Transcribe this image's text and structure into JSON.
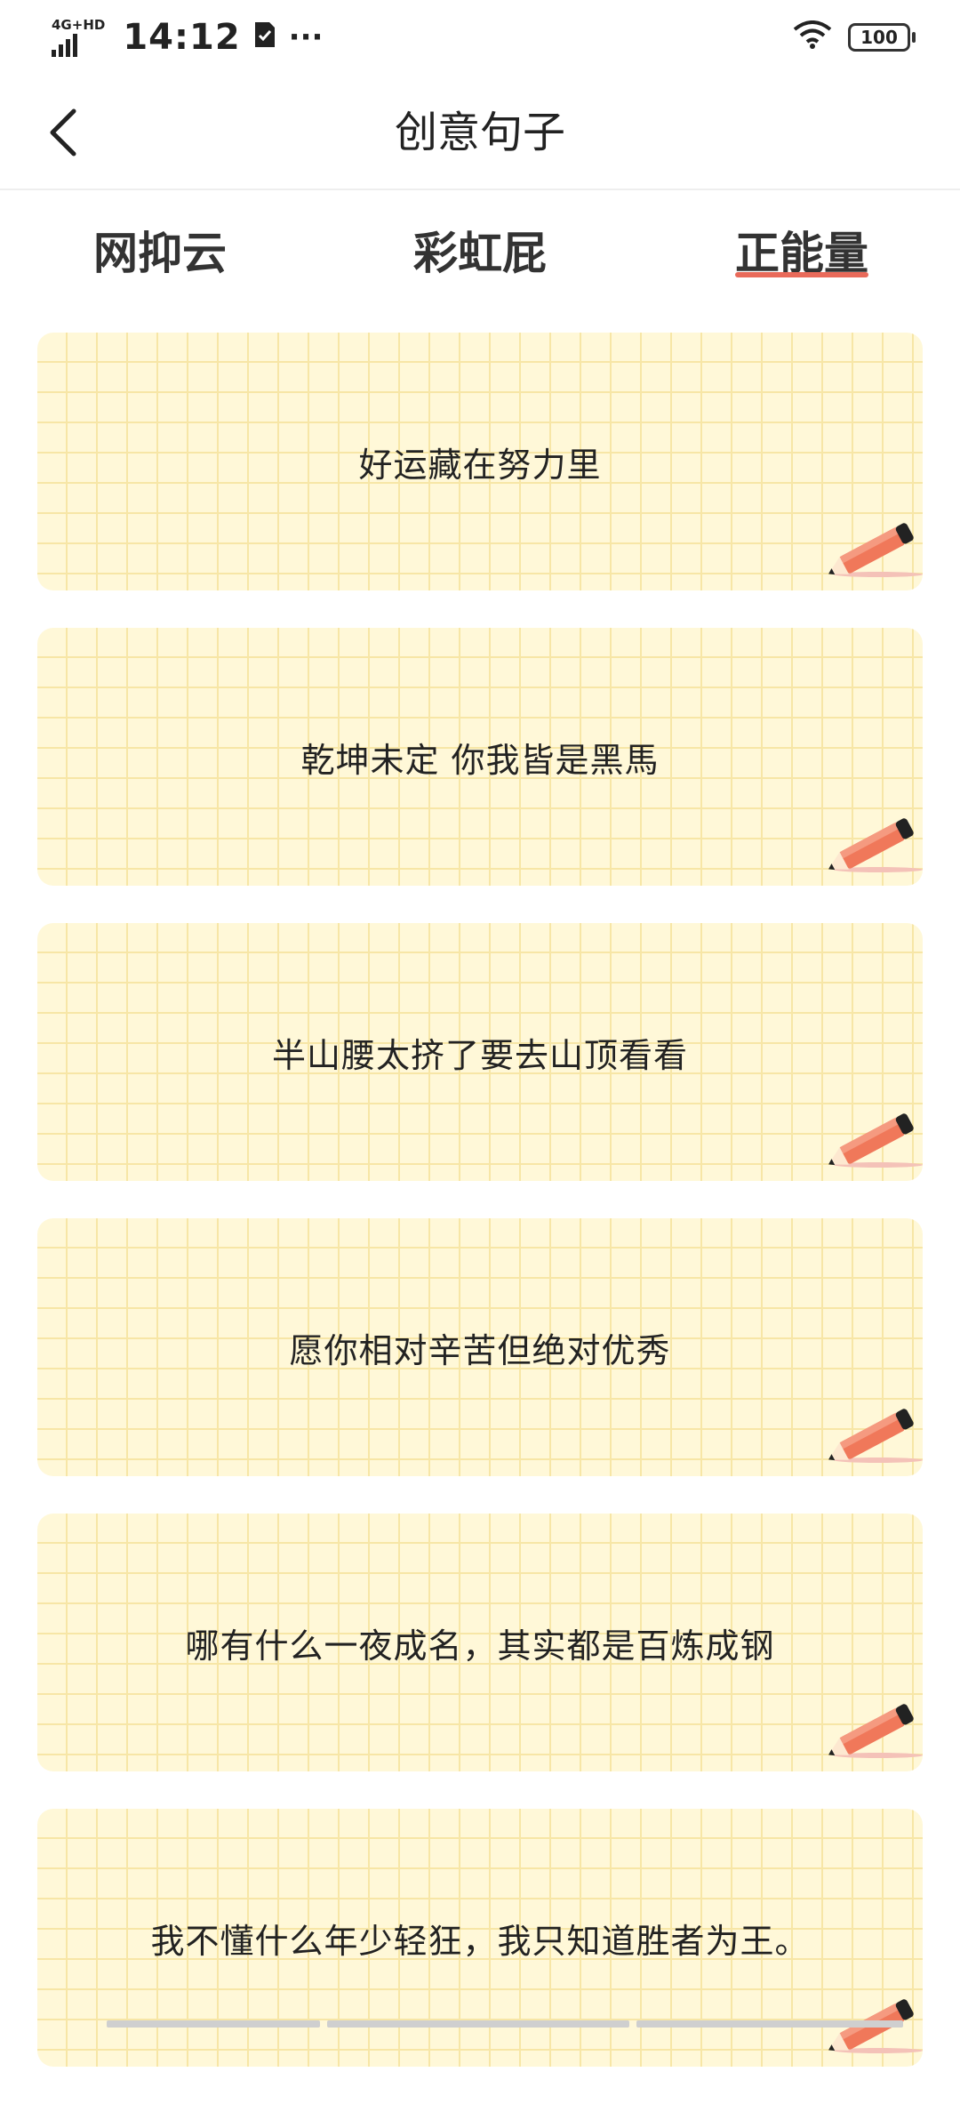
{
  "status_bar": {
    "network": "4G+HD",
    "time": "14:12",
    "battery": "100",
    "more": "···"
  },
  "header": {
    "title": "创意句子"
  },
  "tabs": [
    {
      "label": "网抑云",
      "active": false
    },
    {
      "label": "彩虹屁",
      "active": false
    },
    {
      "label": "正能量",
      "active": true
    }
  ],
  "sentences": [
    "好运藏在努力里",
    "乾坤未定 你我皆是黑馬",
    "半山腰太挤了要去山顶看看",
    "愿你相对辛苦但绝对优秀",
    "哪有什么一夜成名，其实都是百炼成钢",
    "我不懂什么年少轻狂，我只知道胜者为王。"
  ],
  "colors": {
    "accent": "#e96a5a",
    "card_bg": "#fff8d8",
    "grid": "#f7e6a6",
    "pencil": "#f0785a"
  }
}
